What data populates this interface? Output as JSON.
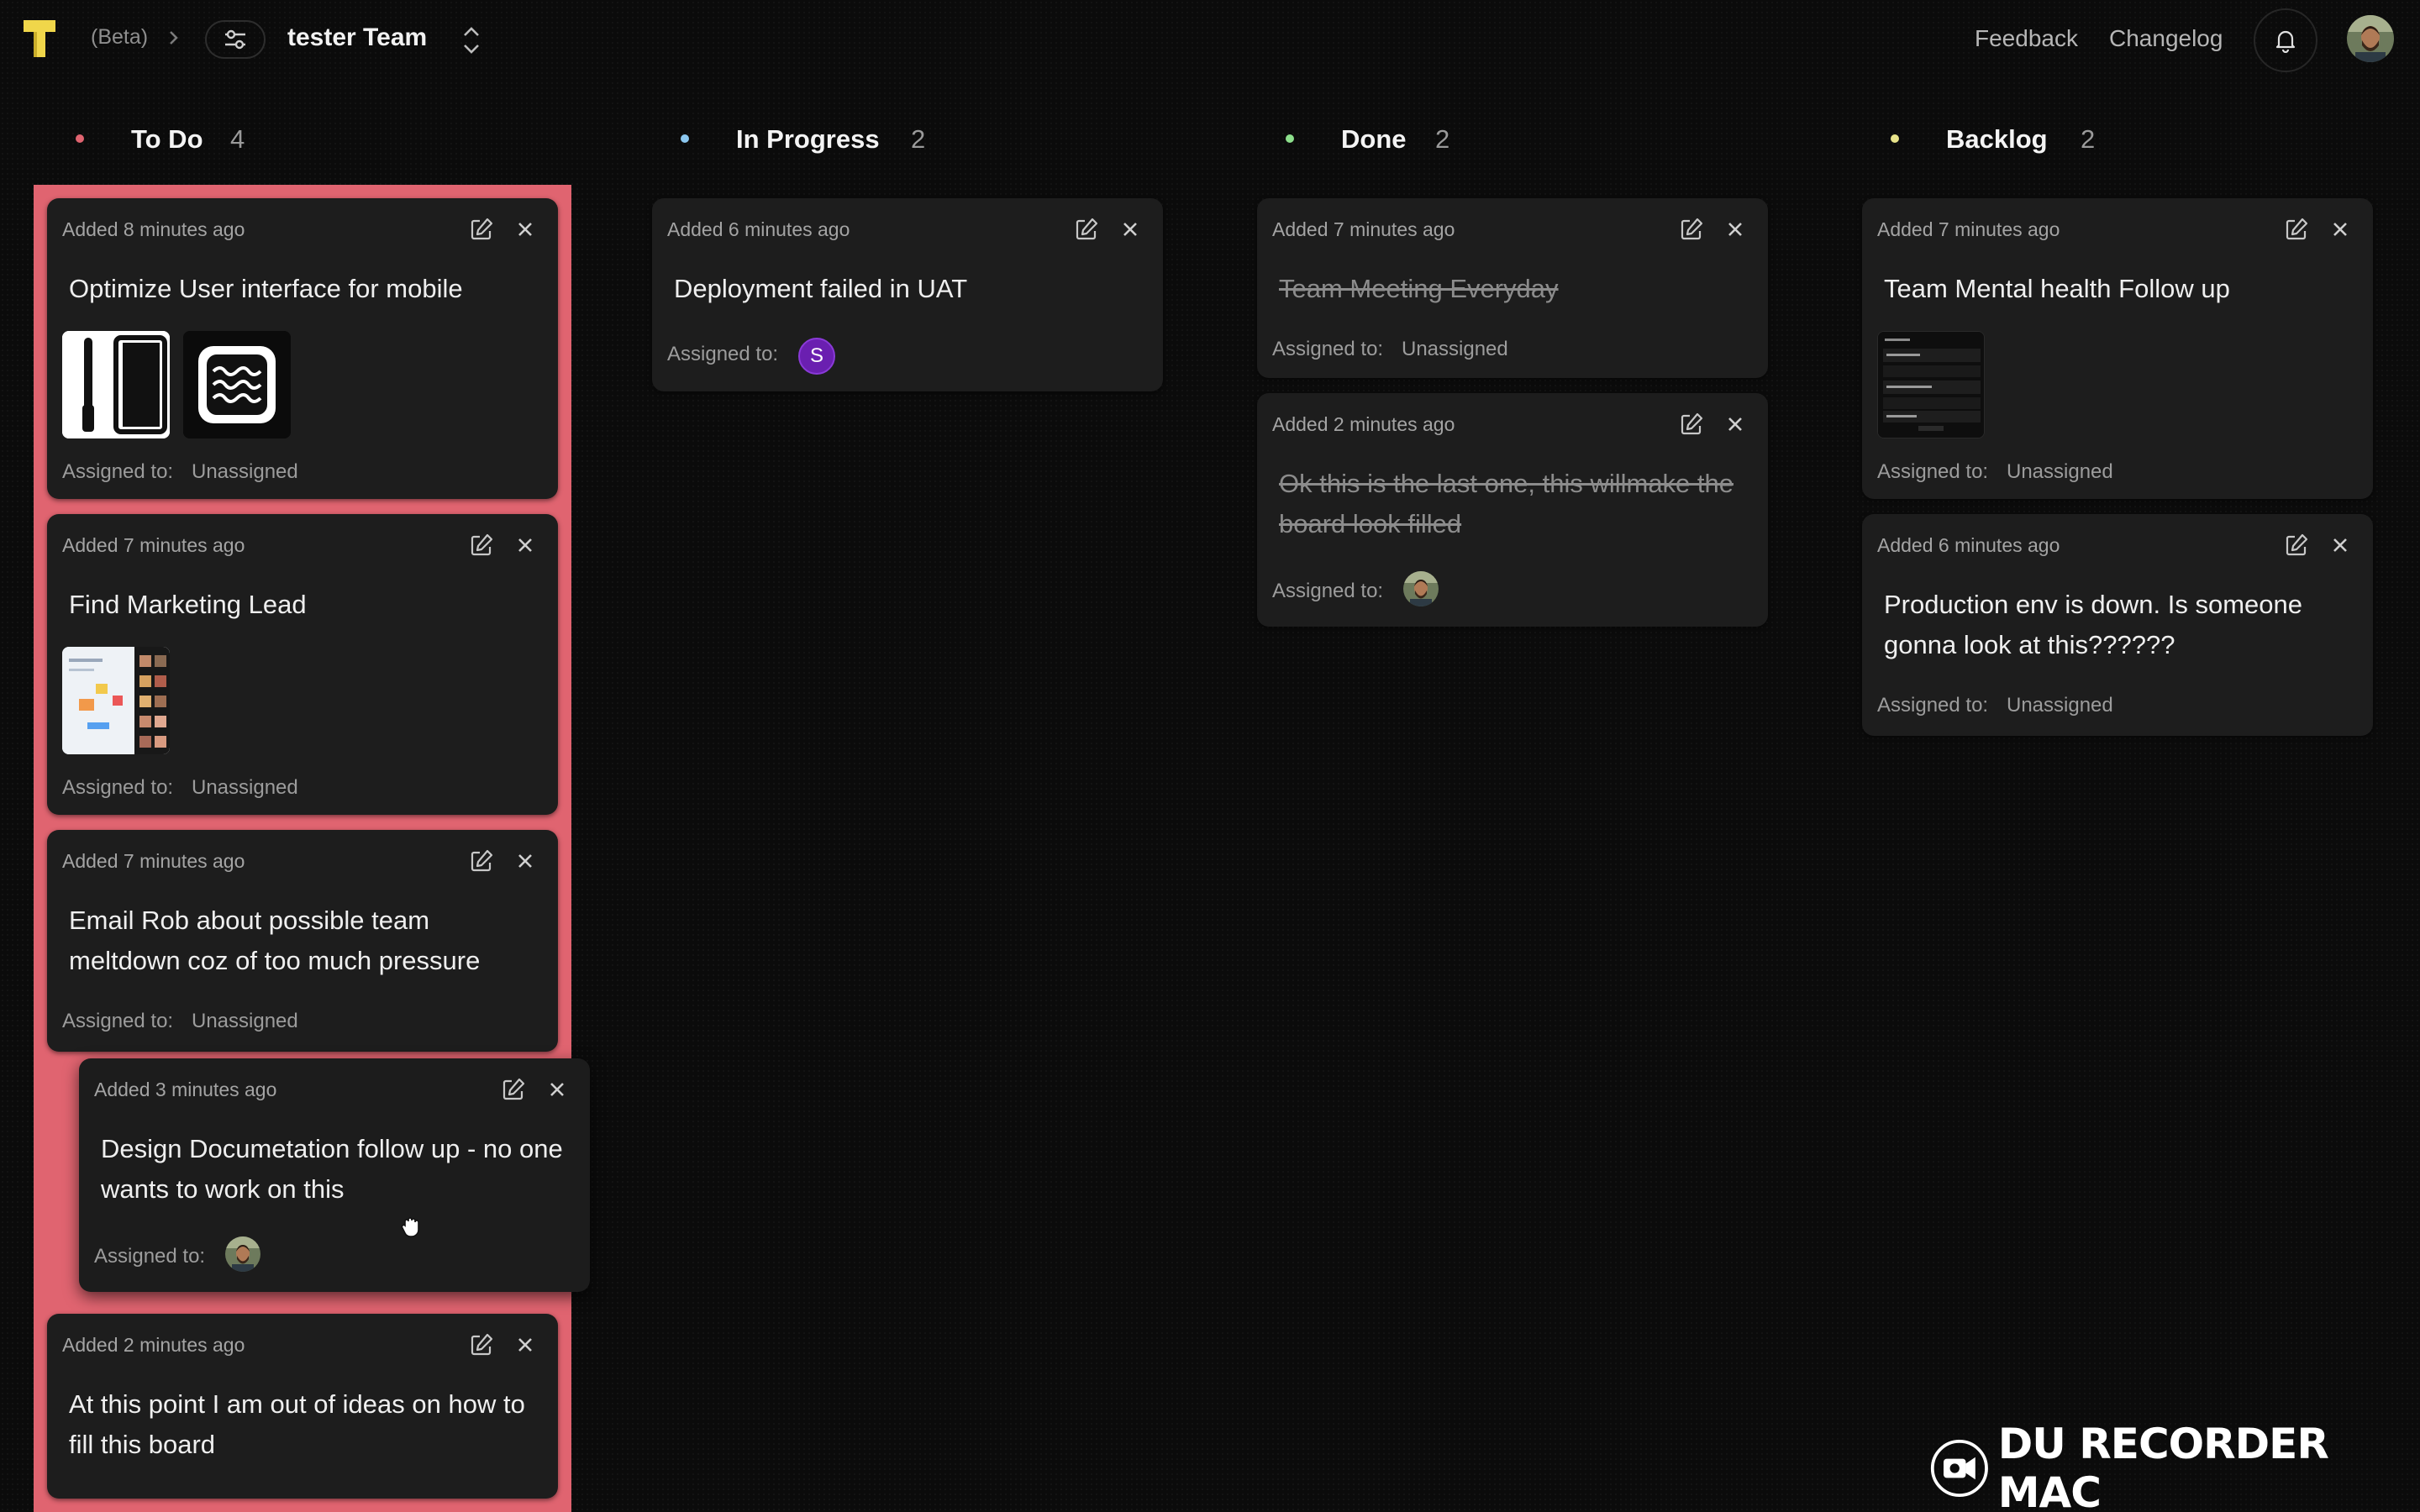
{
  "header": {
    "beta_label": "(Beta)",
    "team_name": "tester Team",
    "feedback_label": "Feedback",
    "changelog_label": "Changelog"
  },
  "columns": [
    {
      "title": "To Do",
      "count": "4",
      "dot_color": "#e06470"
    },
    {
      "title": "In Progress",
      "count": "2",
      "dot_color": "#8cc8f0"
    },
    {
      "title": "Done",
      "count": "2",
      "dot_color": "#8de08c"
    },
    {
      "title": "Backlog",
      "count": "2",
      "dot_color": "#e8e48a"
    }
  ],
  "cards": {
    "todo_1": {
      "added": "Added 8 minutes ago",
      "title": "Optimize User interface for mobile",
      "assigned_label": "Assigned to:",
      "assigned": "Unassigned"
    },
    "todo_2": {
      "added": "Added 7 minutes ago",
      "title": "Find Marketing Lead",
      "assigned_label": "Assigned to:",
      "assigned": "Unassigned"
    },
    "todo_3": {
      "added": "Added 7 minutes ago",
      "title": "Email Rob about possible team meltdown coz of too much pressure",
      "assigned_label": "Assigned to:",
      "assigned": "Unassigned"
    },
    "todo_4": {
      "added": "Added 3 minutes ago",
      "title": "Design Documetation follow up - no one wants to work on this",
      "assigned_label": "Assigned to:"
    },
    "todo_5": {
      "added": "Added 2 minutes ago",
      "title": "At this point I am out of ideas on how to fill this board"
    },
    "inprog_1": {
      "added": "Added 6 minutes ago",
      "title": "Deployment failed in UAT",
      "assigned_label": "Assigned to:",
      "assignee_initial": "S"
    },
    "done_1": {
      "added": "Added 7 minutes ago",
      "title": "Team Meeting Everyday",
      "assigned_label": "Assigned to:",
      "assigned": "Unassigned"
    },
    "done_2": {
      "added": "Added 2 minutes ago",
      "title": "Ok this is the last one, this willmake the board look filled",
      "assigned_label": "Assigned to:"
    },
    "backlog_1": {
      "added": "Added 7 minutes ago",
      "title": "Team Mental health Follow up",
      "assigned_label": "Assigned to:",
      "assigned": "Unassigned"
    },
    "backlog_2": {
      "added": "Added 6 minutes ago",
      "title": "Production env is down. Is someone gonna look at this??????",
      "assigned_label": "Assigned to:",
      "assigned": "Unassigned"
    }
  },
  "icons": {
    "logo": "tilde-logo-icon",
    "edit": "edit-icon",
    "close": "close-icon",
    "bell": "bell-icon",
    "filter": "sliders-icon"
  },
  "watermark": "DU RECORDER MAC"
}
